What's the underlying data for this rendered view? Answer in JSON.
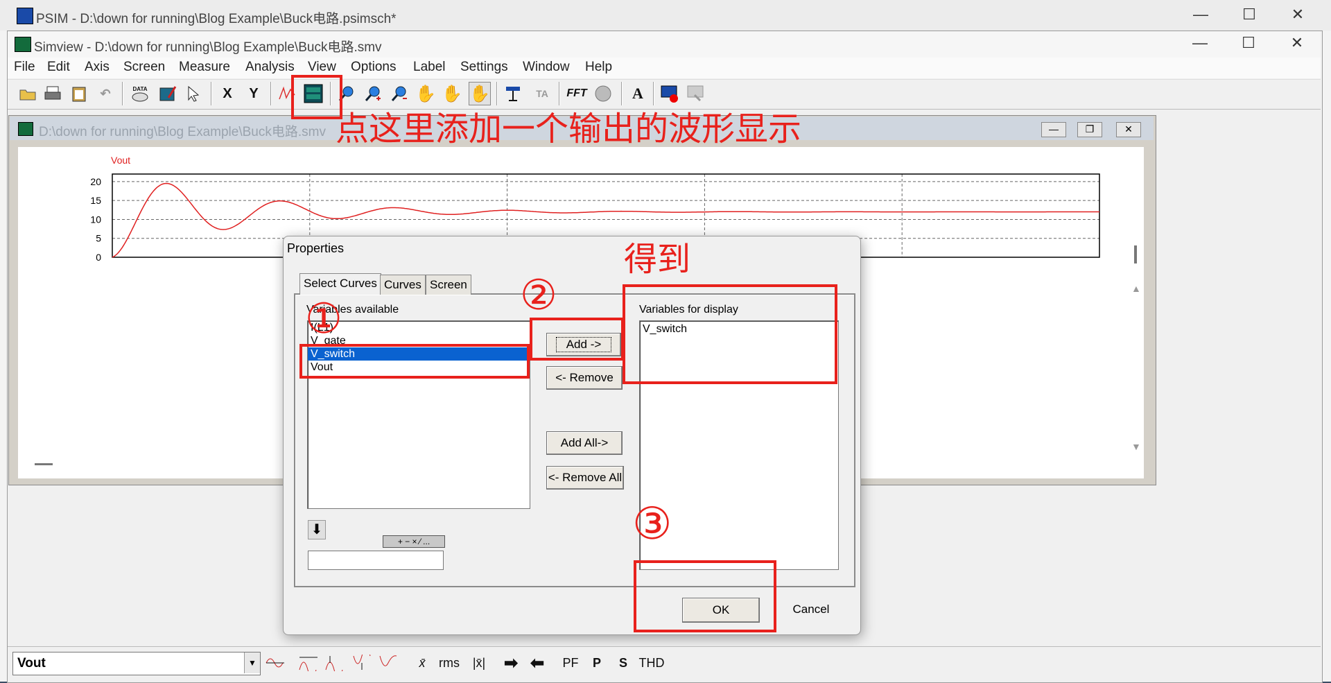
{
  "psim_window": {
    "title": "PSIM - D:\\down for running\\Blog Example\\Buck电路.psimsch*"
  },
  "simview_window": {
    "title": "Simview - D:\\down for running\\Blog Example\\Buck电路.smv"
  },
  "menu": [
    "File",
    "Edit",
    "Axis",
    "Screen",
    "Measure",
    "Analysis",
    "View",
    "Options",
    "Label",
    "Settings",
    "Window",
    "Help"
  ],
  "toolbar": {
    "x_label": "X",
    "y_label": "Y",
    "fft_label": "FFT",
    "text_label": "A",
    "data_label": "DATA"
  },
  "doc_window": {
    "title": "D:\\down for running\\Blog Example\\Buck电路.smv"
  },
  "annotations": {
    "toolbar_hint": "点这里添加一个输出的波形显示",
    "result_label": "得到",
    "step1": "①",
    "step2": "②",
    "step3": "③"
  },
  "chart_data": {
    "type": "line",
    "series": [
      {
        "name": "Vout"
      }
    ],
    "y_ticks": [
      "20",
      "15",
      "10",
      "5",
      "0"
    ],
    "ylim": [
      0,
      22
    ],
    "grid": true,
    "steady_value": 12,
    "peak_value": 20
  },
  "dialog": {
    "title": "Properties",
    "tabs": [
      "Select Curves",
      "Curves",
      "Screen"
    ],
    "available_label": "Variables available",
    "available": [
      "I(L1)",
      "V_gate",
      "V_switch",
      "Vout"
    ],
    "selected_available": "V_switch",
    "display_label": "Variables for display",
    "display": [
      "V_switch"
    ],
    "add": "Add ->",
    "remove": "<- Remove",
    "add_all": "Add All->",
    "remove_all": "<- Remove All",
    "ok": "OK",
    "cancel": "Cancel",
    "ops": "+ − × ⁄ ..."
  },
  "bottom_toolbar": {
    "selected_curve": "Vout",
    "mean_label": "x̄",
    "rms_label": "rms",
    "absmean_label": "|x̄|",
    "pf_label": "PF",
    "p_label": "P",
    "s_label": "S",
    "thd_label": "THD"
  }
}
